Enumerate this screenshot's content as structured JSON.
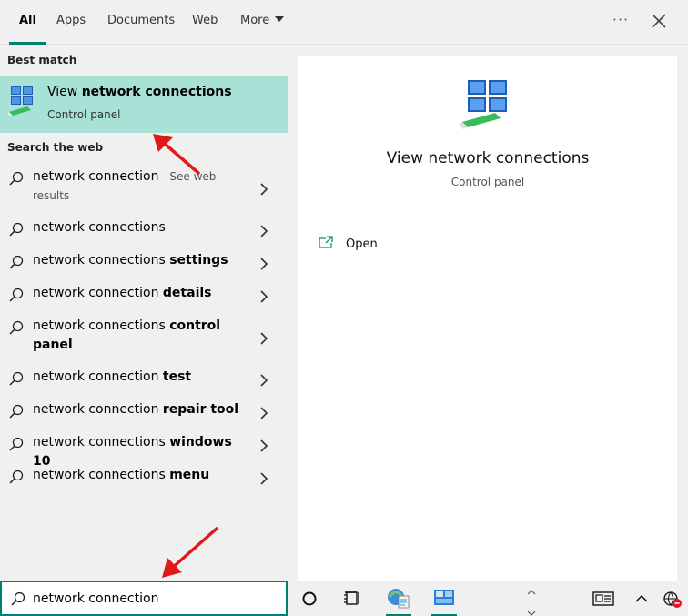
{
  "tabs": [
    {
      "label": "All",
      "active": true
    },
    {
      "label": "Apps"
    },
    {
      "label": "Documents"
    },
    {
      "label": "Web"
    },
    {
      "label": "More"
    }
  ],
  "top_actions": {
    "more_icon": "ellipsis-icon",
    "close_icon": "close-icon"
  },
  "left": {
    "best_match_heading": "Best match",
    "best_match": {
      "title_plain": "View ",
      "title_bold": "network connections",
      "subtitle": "Control panel",
      "icon": "network-connections-icon"
    },
    "search_web_heading": "Search the web",
    "web_results": [
      {
        "plain": "network connection",
        "bold": "",
        "hint": " - See web results"
      },
      {
        "plain": "network connections",
        "bold": "",
        "hint": ""
      },
      {
        "plain": "network connections ",
        "bold": "settings",
        "hint": ""
      },
      {
        "plain": "network connection ",
        "bold": "details",
        "hint": ""
      },
      {
        "plain": "network connections ",
        "bold": "control panel",
        "hint": ""
      },
      {
        "plain": "network connection ",
        "bold": "test",
        "hint": ""
      },
      {
        "plain": "network connection ",
        "bold": "repair tool",
        "hint": ""
      },
      {
        "plain": "network connections ",
        "bold": "windows 10",
        "hint": ""
      },
      {
        "plain": "network connections ",
        "bold": "menu",
        "hint": ""
      }
    ]
  },
  "right": {
    "title": "View network connections",
    "subtitle": "Control panel",
    "actions": [
      {
        "label": "Open",
        "icon": "open-icon"
      }
    ]
  },
  "search": {
    "value": "network connection"
  },
  "taskbar": {
    "items": [
      "cortana-icon",
      "task-view-icon",
      "ie-tile-icon",
      "control-panel-icon"
    ],
    "tray": [
      "scroll-up-icon",
      "scroll-down-icon",
      "news-icon",
      "chevron-up-icon",
      "network-disconnected-icon"
    ]
  },
  "colors": {
    "accent": "#008272",
    "highlight": "#a8e1d6",
    "annotation": "#e0191b"
  }
}
